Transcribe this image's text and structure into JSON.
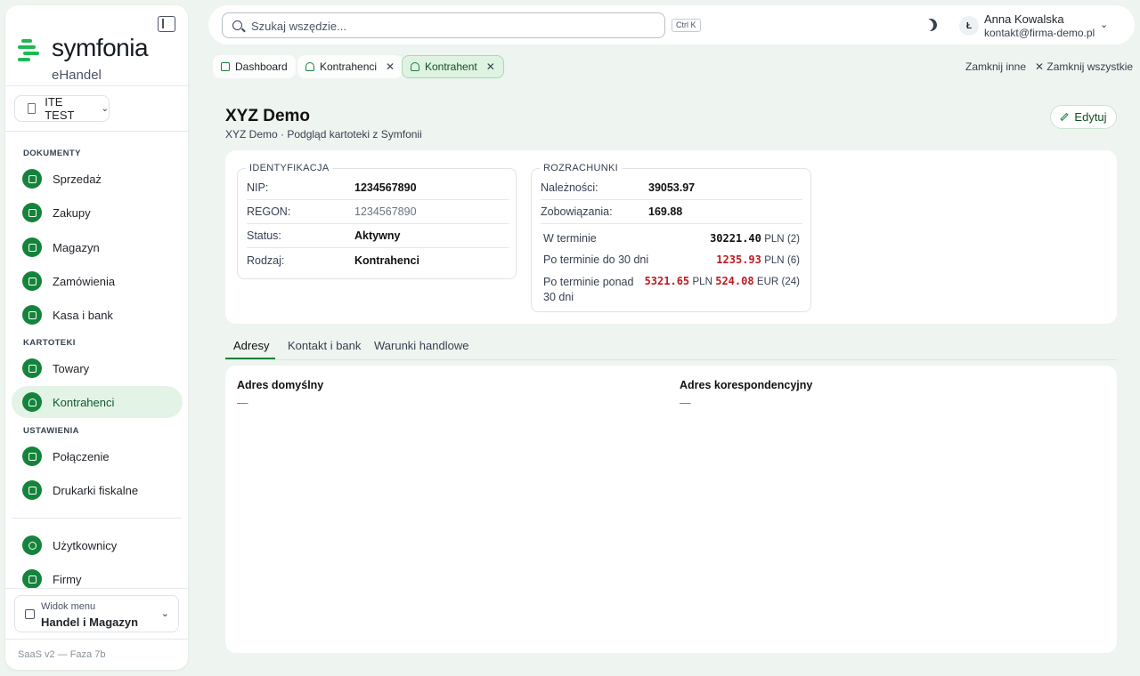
{
  "brand": {
    "name": "symfonia",
    "product": "eHandel",
    "accent": "#14833b"
  },
  "company": {
    "label": "ITE TEST"
  },
  "sidebar": {
    "sections": [
      {
        "label": "DOKUMENTY"
      },
      {
        "label": "KARTOTEKI"
      },
      {
        "label": "USTAWIENIA"
      }
    ],
    "items": [
      {
        "label": "Sprzedaż",
        "icon": "receipt-icon"
      },
      {
        "label": "Zakupy",
        "icon": "box-icon"
      },
      {
        "label": "Magazyn",
        "icon": "warehouse-icon"
      },
      {
        "label": "Zamówienia",
        "icon": "box-icon"
      },
      {
        "label": "Kasa i bank",
        "icon": "box-icon"
      },
      {
        "label": "Towary",
        "icon": "box-icon"
      },
      {
        "label": "Kontrahenci",
        "icon": "users-icon",
        "active": true
      },
      {
        "label": "Połączenie",
        "icon": "box-icon"
      },
      {
        "label": "Drukarki fiskalne",
        "icon": "box-icon"
      },
      {
        "label": "Użytkownicy",
        "icon": "user-cog-icon"
      },
      {
        "label": "Firmy",
        "icon": "building-icon"
      }
    ],
    "menu_view": {
      "label": "Widok menu",
      "value": "Handel i Magazyn"
    },
    "version": "SaaS v2 — Faza 7b"
  },
  "topbar": {
    "search_placeholder": "Szukaj wszędzie...",
    "shortcut": "Ctrl K",
    "user": {
      "initial": "Ł",
      "name": "Anna Kowalska",
      "email": "kontakt@firma-demo.pl"
    }
  },
  "tabs": [
    {
      "label": "Dashboard",
      "closable": false
    },
    {
      "label": "Kontrahenci",
      "closable": true
    },
    {
      "label": "Kontrahent",
      "closable": true,
      "active": true
    }
  ],
  "tab_actions": {
    "close_others": "Zamknij inne",
    "close_all": "Zamknij wszystkie"
  },
  "page": {
    "title": "XYZ Demo",
    "subtitle": "XYZ Demo · Podgląd kartoteki z Symfonii",
    "edit_label": "Edytuj"
  },
  "identification": {
    "legend": "IDENTYFIKACJA",
    "rows": [
      {
        "key": "NIP:",
        "value": "1234567890"
      },
      {
        "key": "REGON:",
        "value": "1234567890"
      },
      {
        "key": "Status:",
        "value": "Aktywny"
      },
      {
        "key": "Rodzaj:",
        "value": "Kontrahenci"
      }
    ]
  },
  "settlements": {
    "legend": "ROZRACHUNKI",
    "receivables": {
      "key": "Należności:",
      "value": "39053.97"
    },
    "liabilities": {
      "key": "Zobowiązania:",
      "value": "169.88"
    },
    "on_time": {
      "label": "W terminie",
      "amount": "30221.40",
      "currency": "PLN",
      "count": "(2)"
    },
    "overdue_30": {
      "label": "Po terminie do 30 dni",
      "amount": "1235.93",
      "currency": "PLN",
      "count": "(6)"
    },
    "overdue_over_30": {
      "label_line1": "Po terminie ponad",
      "label_line2": "30 dni",
      "amount_pln": "5321.65",
      "currency_pln": "PLN",
      "amount_eur": "524.08",
      "currency_eur": "EUR",
      "count": "(24)"
    }
  },
  "content_tabs": [
    "Adresy",
    "Kontakt i bank",
    "Warunki handlowe"
  ],
  "addresses": {
    "default": {
      "title": "Adres domyślny",
      "value": "—"
    },
    "correspondence": {
      "title": "Adres korespondencyjny",
      "value": "—"
    }
  }
}
